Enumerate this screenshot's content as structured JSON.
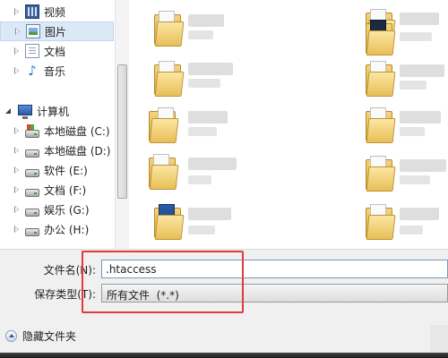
{
  "nav": {
    "items": [
      {
        "label": "视频",
        "icon": "video-library-icon"
      },
      {
        "label": "图片",
        "icon": "picture-library-icon"
      },
      {
        "label": "文档",
        "icon": "document-library-icon"
      },
      {
        "label": "音乐",
        "icon": "music-library-icon"
      },
      {
        "label": "计算机",
        "icon": "computer-icon"
      },
      {
        "label": "本地磁盘 (C:)",
        "icon": "system-drive-icon"
      },
      {
        "label": "本地磁盘 (D:)",
        "icon": "drive-icon"
      },
      {
        "label": "软件 (E:)",
        "icon": "drive-icon"
      },
      {
        "label": "文档 (F:)",
        "icon": "drive-icon"
      },
      {
        "label": "娱乐 (G:)",
        "icon": "drive-icon"
      },
      {
        "label": "办公 (H:)",
        "icon": "drive-icon"
      }
    ],
    "selected": "图片"
  },
  "form": {
    "filename_label": "文件名(N):",
    "filename_value": ".htaccess",
    "filetype_label": "保存类型(T):",
    "filetype_value": "所有文件  (*.*)"
  },
  "footer": {
    "hide_folders_label": "隐藏文件夹"
  },
  "colors": {
    "highlight": "#e03c3c",
    "selection": "#dbe8f6"
  }
}
